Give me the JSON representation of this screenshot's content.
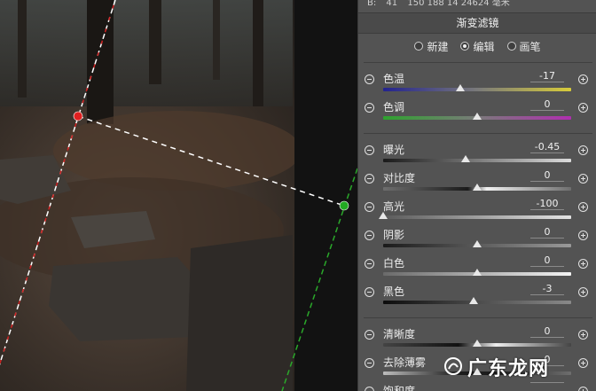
{
  "app": {
    "accent": "#535353"
  },
  "top_info": {
    "b_label": "B:",
    "b_value": "41",
    "cut_text": "150 188  14 24624 毫米"
  },
  "panel": {
    "title": "渐变滤镜",
    "modes": [
      {
        "label": "新建",
        "selected": false
      },
      {
        "label": "编辑",
        "selected": true
      },
      {
        "label": "画笔",
        "selected": false
      }
    ]
  },
  "sliders": [
    {
      "label": "色温",
      "value": "-17",
      "level": 0.41,
      "track": "linear-gradient(90deg,#23238f,#7a7a7a,#d8cc3a)"
    },
    {
      "label": "色调",
      "value": "0",
      "level": 0.5,
      "track": "linear-gradient(90deg,#2ea22e,#7a7a7a,#b02eb0)"
    },
    {
      "label": "曝光",
      "value": "-0.45",
      "level": 0.44,
      "track": "linear-gradient(90deg,#1a1a1a,#dcdcdc)"
    },
    {
      "label": "对比度",
      "value": "0",
      "level": 0.5,
      "track": "linear-gradient(90deg,#6e6e6e,#1a1a1a 45%,#f0f0f0 55%,#6e6e6e)"
    },
    {
      "label": "高光",
      "value": "-100",
      "level": 0.0,
      "track": "linear-gradient(90deg,#5a5a5a,#e4e4e4)"
    },
    {
      "label": "阴影",
      "value": "0",
      "level": 0.5,
      "track": "linear-gradient(90deg,#1a1a1a,#9a9a9a)"
    },
    {
      "label": "白色",
      "value": "0",
      "level": 0.5,
      "track": "linear-gradient(90deg,#6a6a6a,#f4f4f4)"
    },
    {
      "label": "黑色",
      "value": "-3",
      "level": 0.48,
      "track": "linear-gradient(90deg,#0c0c0c,#8a8a8a)"
    },
    {
      "label": "清晰度",
      "value": "0",
      "level": 0.5,
      "track": "linear-gradient(90deg,#444,#111 40%,#eee 60%,#444)"
    },
    {
      "label": "去除薄雾",
      "value": "0",
      "level": 0.5,
      "track": "linear-gradient(90deg,#bdbdbd,#1c1c1c 40%,#1c1c1c 60%,#6e6e6e)"
    },
    {
      "label": "饱和度",
      "value": "",
      "level": 0.5,
      "track": "linear-gradient(90deg,#888,#c33)"
    }
  ],
  "watermark": {
    "text": "广东龙网"
  },
  "colors": {
    "red_pin": "#e02020",
    "green_pin": "#22aa22"
  }
}
